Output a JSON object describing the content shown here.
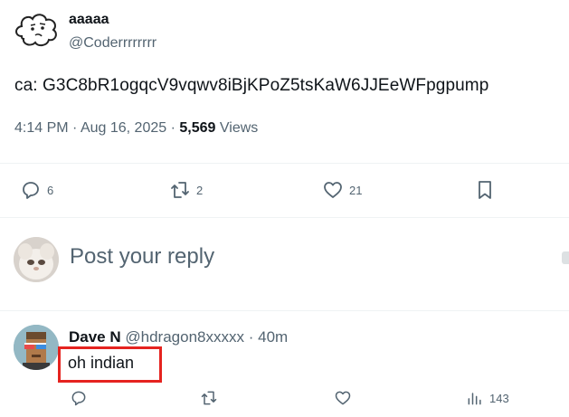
{
  "tweet": {
    "author_name": "aaaaa",
    "author_handle": "@Coderrrrrrrr",
    "text": "ca: G3C8bR1ogqcV9vqwv8iBjKPoZ5tsKaW6JJEeWFpgpump",
    "time": "4:14 PM",
    "date": "Aug 16, 2025",
    "views_count": "5,569",
    "views_label": "Views",
    "dot": "·"
  },
  "actions": {
    "replies": "6",
    "reposts": "2",
    "likes": "21"
  },
  "composer": {
    "placeholder": "Post your reply"
  },
  "reply": {
    "author_name": "Dave N",
    "author_handle": "@hdragon8xxxxx",
    "age": "40m",
    "text": "oh indian",
    "views": "143"
  },
  "icons": {
    "reply": "reply-icon",
    "repost": "repost-icon",
    "like": "heart-icon",
    "bookmark": "bookmark-icon",
    "views": "views-icon"
  },
  "colors": {
    "text": "#0f1419",
    "muted": "#536471",
    "divider": "#eff3f4",
    "highlight": "#e5231f"
  }
}
